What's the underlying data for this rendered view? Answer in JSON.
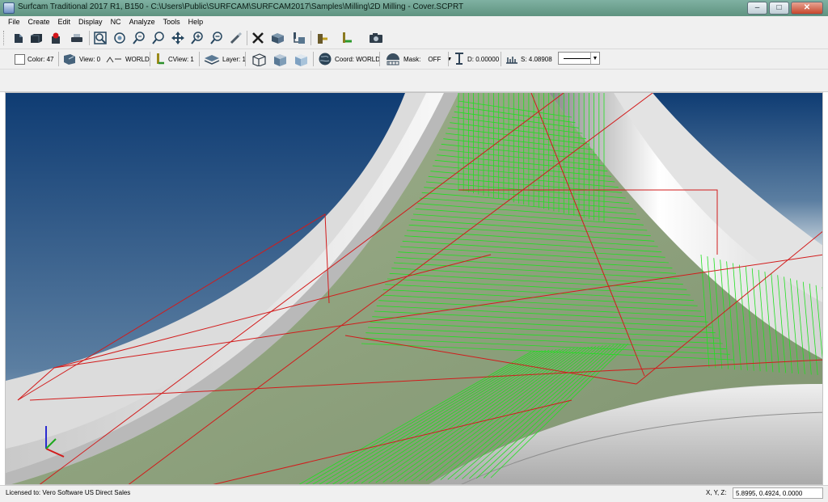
{
  "window": {
    "title": "Surfcam Traditional 2017 R1, B150 - C:\\Users\\Public\\SURFCAM\\SURFCAM2017\\Samples\\Milling\\2D Milling - Cover.SCPRT",
    "minimize_glyph": "–",
    "maximize_glyph": "□",
    "close_glyph": "✕"
  },
  "menu": [
    "File",
    "Create",
    "Edit",
    "Display",
    "NC",
    "Analyze",
    "Tools",
    "Help"
  ],
  "toolbar_icons": [
    "open-icon",
    "save-icon",
    "record-icon",
    "print-icon",
    "zoom-fit-icon",
    "zoom-window-icon",
    "zoom-previous-icon",
    "zoom-icon",
    "pan-icon",
    "zoom-in-icon",
    "zoom-out-icon",
    "repaint-icon",
    "delete-icon",
    "blank-icon",
    "unblank-icon",
    "view-icon",
    "cview-icon",
    "camera-icon"
  ],
  "settings": {
    "color": "Color: 47",
    "view": "View: 0",
    "view_ref": "WORLD",
    "cview": "CView: 1",
    "layer": "Layer: 1",
    "coord": "Coord: WORLD",
    "mask_label": "Mask:",
    "mask_value": "OFF",
    "depth": "D: 0.00000",
    "step": "S: 4.08908"
  },
  "status": {
    "license": "Licensed to: Vero Software US Direct Sales",
    "xyz_label": "X, Y, Z:",
    "coordinates": "5.8995, 0.4924, 0.0000"
  },
  "colors": {
    "viewport_sky_top": "#0f3c73",
    "viewport_sky_bottom": "#c7d3dc",
    "toolpath_green": "#20e020",
    "toolpath_red": "#d21b1b",
    "part_surface": "#8fa27c"
  }
}
